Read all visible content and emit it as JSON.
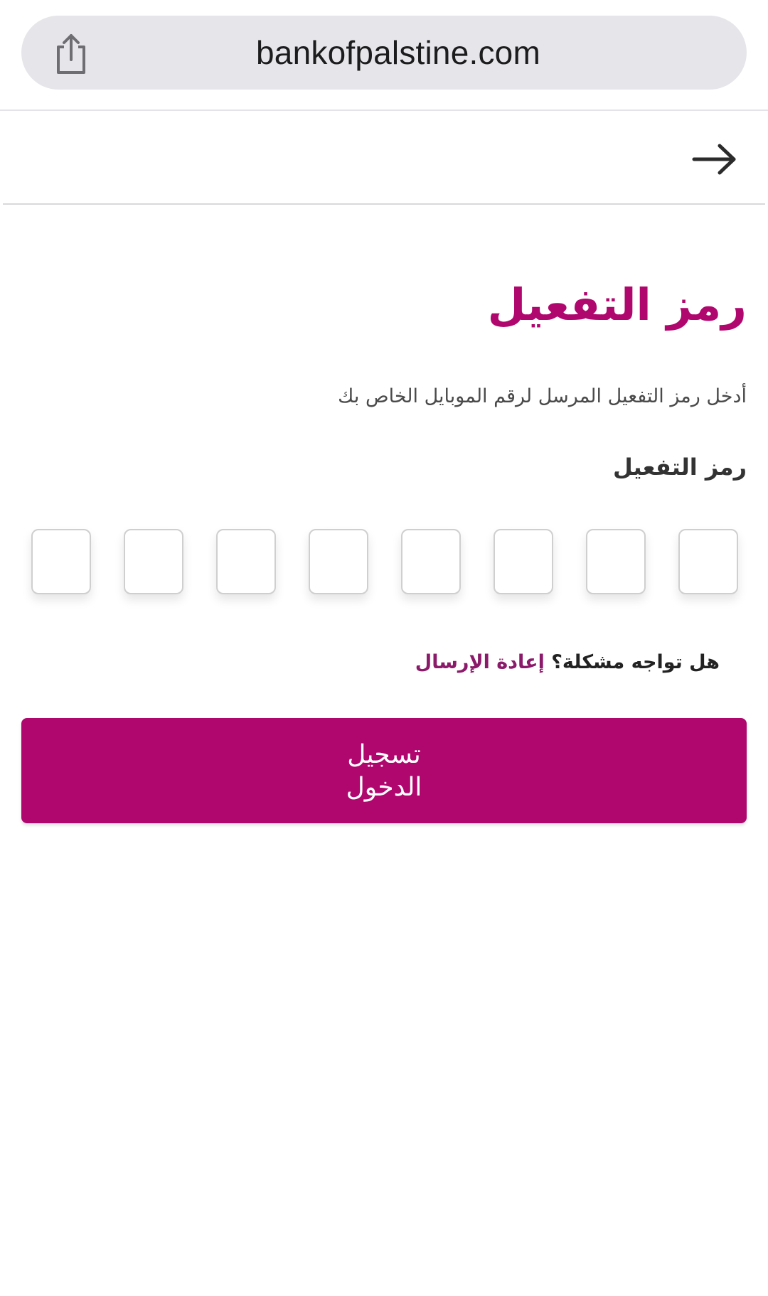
{
  "browser": {
    "url": "bankofpalstine.com",
    "share_icon": "share-icon"
  },
  "header": {
    "back_icon": "arrow-right-icon"
  },
  "main": {
    "title": "رمز التفعيل",
    "subtitle": "أدخل رمز التفعيل المرسل لرقم الموبايل الخاص بك",
    "code_label": "رمز التفعيل",
    "otp_digits": [
      "",
      "",
      "",
      "",
      "",
      "",
      "",
      ""
    ],
    "problem_text": "هل تواجه مشكلة؟",
    "resend_link": "إعادة الإرسال",
    "login_button_label": "تسجيل الدخول"
  },
  "colors": {
    "brand": "#b0076e",
    "link": "#8c1a6a"
  }
}
